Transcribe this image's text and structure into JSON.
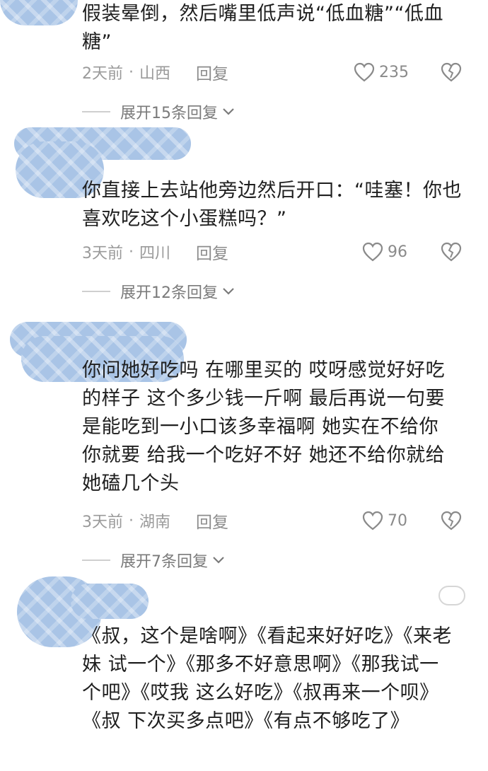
{
  "comments": [
    {
      "text": "假装晕倒，然后嘴里低声说“低血糖”“低血糖”",
      "time": "2天前",
      "sep": "·",
      "location": "山西",
      "reply": "回复",
      "likes": "235",
      "expand": "展开15条回复"
    },
    {
      "text": "你直接上去站他旁边然后开口：“哇塞！你也喜欢吃这个小蛋糕吗？”",
      "time": "3天前",
      "sep": "·",
      "location": "四川",
      "reply": "回复",
      "likes": "96",
      "expand": "展开12条回复"
    },
    {
      "text": "你问她好吃吗  在哪里买的  哎呀感觉好好吃的样子  这个多少钱一斤啊  最后再说一句要是能吃到一小口该多幸福啊  她实在不给你  你就要  给我一个吃好不好  她还不给你就给她磕几个头",
      "time": "3天前",
      "sep": "·",
      "location": "湖南",
      "reply": "回复",
      "likes": "70",
      "expand": "展开7条回复"
    },
    {
      "text": "《叔，这个是啥啊》《看起来好好吃》《来老妹 试一个》《那多不好意思啊》《那我试一个吧》《哎我 这么好吃》《叔再来一个呗》《叔 下次买多点吧》《有点不够吃了》"
    }
  ],
  "icons": {
    "like": "heart-outline-icon",
    "dislike": "broken-heart-icon",
    "expand": "chevron-down-icon"
  },
  "colors": {
    "avatar_redaction": "#a9c4e6",
    "meta_text": "#9a9a9a"
  }
}
